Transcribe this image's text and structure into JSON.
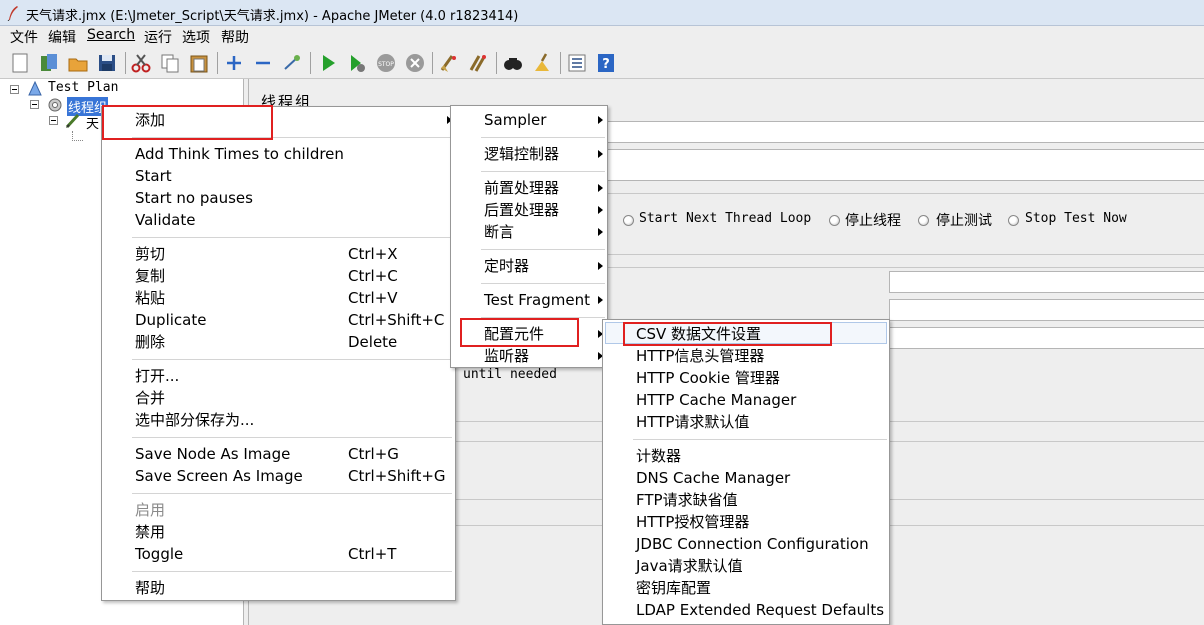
{
  "window": {
    "title": "天气请求.jmx (E:\\Jmeter_Script\\天气请求.jmx) - Apache JMeter (4.0 r1823414)"
  },
  "menubar": {
    "items": [
      "文件",
      "编辑",
      "Search",
      "运行",
      "选项",
      "帮助"
    ]
  },
  "toolbar": {
    "icons": [
      "new-icon",
      "templates-icon",
      "open-icon",
      "save-icon",
      "cut-icon",
      "copy-icon",
      "paste-icon",
      "expand-icon",
      "collapse-icon",
      "toggle-icon",
      "start-icon",
      "start-no-pause-icon",
      "stop-icon",
      "shutdown-icon",
      "clear-icon",
      "clear-all-icon",
      "search-icon",
      "reset-search-icon",
      "function-helper-icon",
      "help-icon"
    ]
  },
  "tree": {
    "test_plan": "Test Plan",
    "thread_group": "线程组",
    "child_partial": "天"
  },
  "right_pane": {
    "title": "线程组",
    "radio_options": [
      "Start Next Thread Loop",
      "停止线程",
      "停止测试",
      "Stop Test Now"
    ],
    "loop_text": "until needed"
  },
  "context_menu": {
    "add": "添加",
    "add_think_times": "Add Think Times to children",
    "start": "Start",
    "start_no_pauses": "Start no pauses",
    "validate": "Validate",
    "cut": "剪切",
    "cut_key": "Ctrl+X",
    "copy": "复制",
    "copy_key": "Ctrl+C",
    "paste": "粘贴",
    "paste_key": "Ctrl+V",
    "duplicate": "Duplicate",
    "duplicate_key": "Ctrl+Shift+C",
    "delete": "删除",
    "delete_key": "Delete",
    "open": "打开...",
    "merge": "合并",
    "save_selection": "选中部分保存为...",
    "save_node_image": "Save Node As Image",
    "save_node_image_key": "Ctrl+G",
    "save_screen_image": "Save Screen As Image",
    "save_screen_image_key": "Ctrl+Shift+G",
    "enable": "启用",
    "disable": "禁用",
    "toggle": "Toggle",
    "toggle_key": "Ctrl+T",
    "help": "帮助"
  },
  "add_submenu": {
    "sampler": "Sampler",
    "logic_controller": "逻辑控制器",
    "pre_processor": "前置处理器",
    "post_processor": "后置处理器",
    "assertion": "断言",
    "timer": "定时器",
    "test_fragment": "Test Fragment",
    "config_element": "配置元件",
    "listener": "监听器"
  },
  "config_submenu": {
    "items": [
      "CSV 数据文件设置",
      "HTTP信息头管理器",
      "HTTP Cookie 管理器",
      "HTTP Cache Manager",
      "HTTP请求默认值",
      "计数器",
      "DNS Cache Manager",
      "FTP请求缺省值",
      "HTTP授权管理器",
      "JDBC Connection Configuration",
      "Java请求默认值",
      "密钥库配置",
      "LDAP Extended Request Defaults"
    ]
  },
  "colors": {
    "selection": "#3875d7",
    "highlight_border": "#e02020",
    "menu_bg": "#ffffff"
  }
}
